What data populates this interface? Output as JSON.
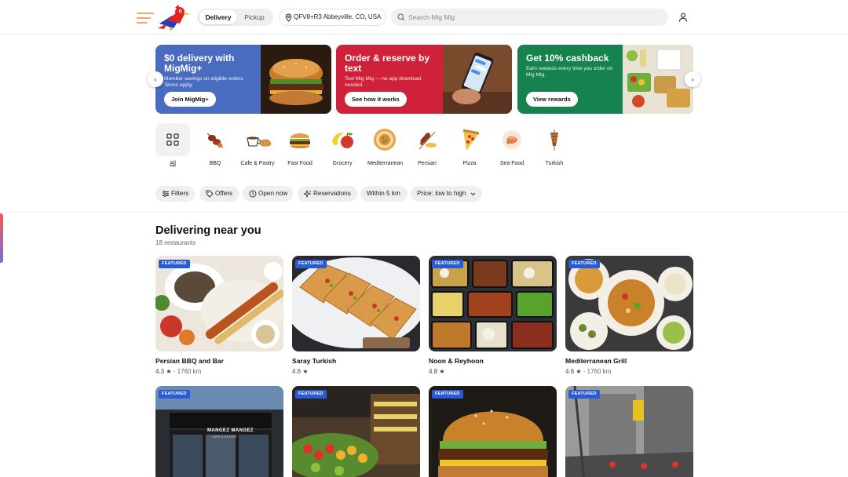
{
  "header": {
    "mode_delivery": "Delivery",
    "mode_pickup": "Pickup",
    "address": "QFV8+R3 Abbeyville, CO, USA",
    "search_placeholder": "Search Mig Mig"
  },
  "banners": [
    {
      "title": "$0 delivery with MigMig+",
      "text": "Member savings on eligible orders. Terms apply.",
      "cta": "Join MigMig+",
      "color": "#4a6cc0"
    },
    {
      "title": "Order & reserve by text",
      "text": "Text Mig Mig — no app download needed.",
      "cta": "See how it works",
      "color": "#d0213a"
    },
    {
      "title": "Get 10% cashback",
      "text": "Earn rewards every time you order on Mig Mig.",
      "cta": "View rewards",
      "color": "#16834f"
    }
  ],
  "carousel": {
    "prev_icon": "chevron-left-icon",
    "next_icon": "chevron-right-icon"
  },
  "categories": [
    {
      "label": "All",
      "icon": "grid-icon"
    },
    {
      "label": "BBQ",
      "icon": "bbq-icon"
    },
    {
      "label": "Cafe & Pastry",
      "icon": "cafe-icon"
    },
    {
      "label": "Fast Food",
      "icon": "burger-icon"
    },
    {
      "label": "Grocery",
      "icon": "grocery-icon"
    },
    {
      "label": "Mediterranean",
      "icon": "mediterranean-icon"
    },
    {
      "label": "Persian",
      "icon": "kebab-icon"
    },
    {
      "label": "Pizza",
      "icon": "pizza-icon"
    },
    {
      "label": "Sea Food",
      "icon": "seafood-icon"
    },
    {
      "label": "Turkish",
      "icon": "doner-icon"
    }
  ],
  "filters": [
    "Filters",
    "Offers",
    "Open now",
    "Reservations",
    "Within 5 km",
    "Price: low to high"
  ],
  "section": {
    "title": "Delivering near you",
    "subtitle": "18 restaurants"
  },
  "featured_label": "FEATURED",
  "restaurants": [
    {
      "name": "Persian BBQ and Bar",
      "rating": "4.3",
      "distance": "1760 km"
    },
    {
      "name": "Saray Turkish",
      "rating": "4.6",
      "distance": ""
    },
    {
      "name": "Noon & Reyhoon",
      "rating": "4.8",
      "distance": ""
    },
    {
      "name": "Mediterranean Grill",
      "rating": "4.6",
      "distance": "1760 km"
    }
  ],
  "storefront_sign": "MANGEZ MANGEZ",
  "storefront_sub": "CAFE & EATERY"
}
